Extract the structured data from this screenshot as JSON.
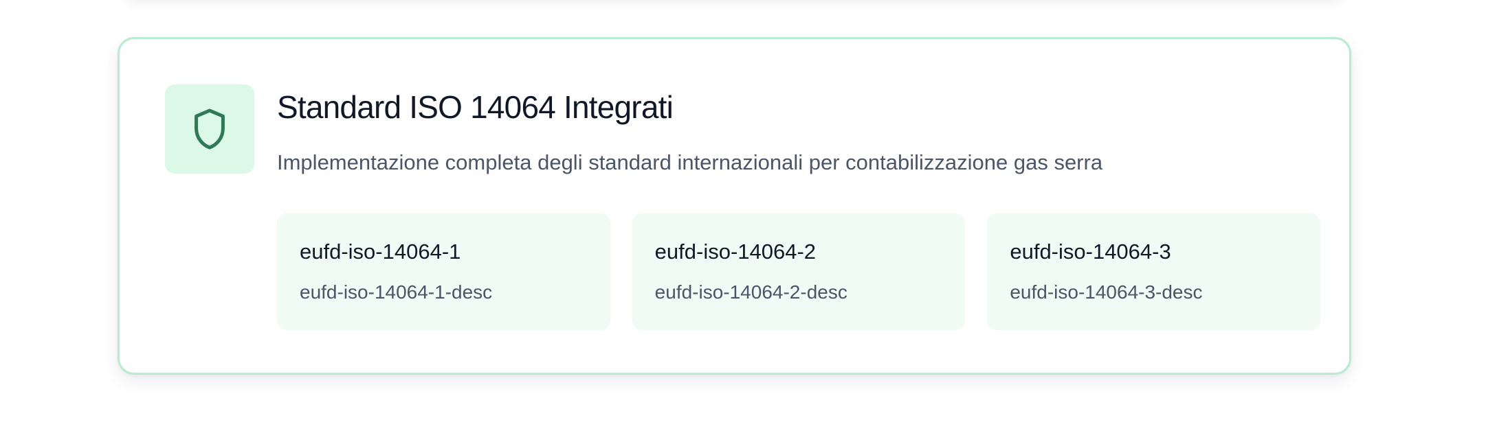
{
  "section": {
    "icon": "shield-icon",
    "title": "Standard ISO 14064 Integrati",
    "description": "Implementazione completa degli standard internazionali per contabilizzazione gas serra",
    "standards": [
      {
        "name": "eufd-iso-14064-1",
        "desc": "eufd-iso-14064-1-desc"
      },
      {
        "name": "eufd-iso-14064-2",
        "desc": "eufd-iso-14064-2-desc"
      },
      {
        "name": "eufd-iso-14064-3",
        "desc": "eufd-iso-14064-3-desc"
      }
    ]
  },
  "colors": {
    "card_border": "#b8ecd0",
    "icon_bg": "#dcf8e7",
    "icon_stroke": "#2f7a55",
    "tile_bg": "#effbf4",
    "previous_card_border": "#b9dbf1"
  }
}
